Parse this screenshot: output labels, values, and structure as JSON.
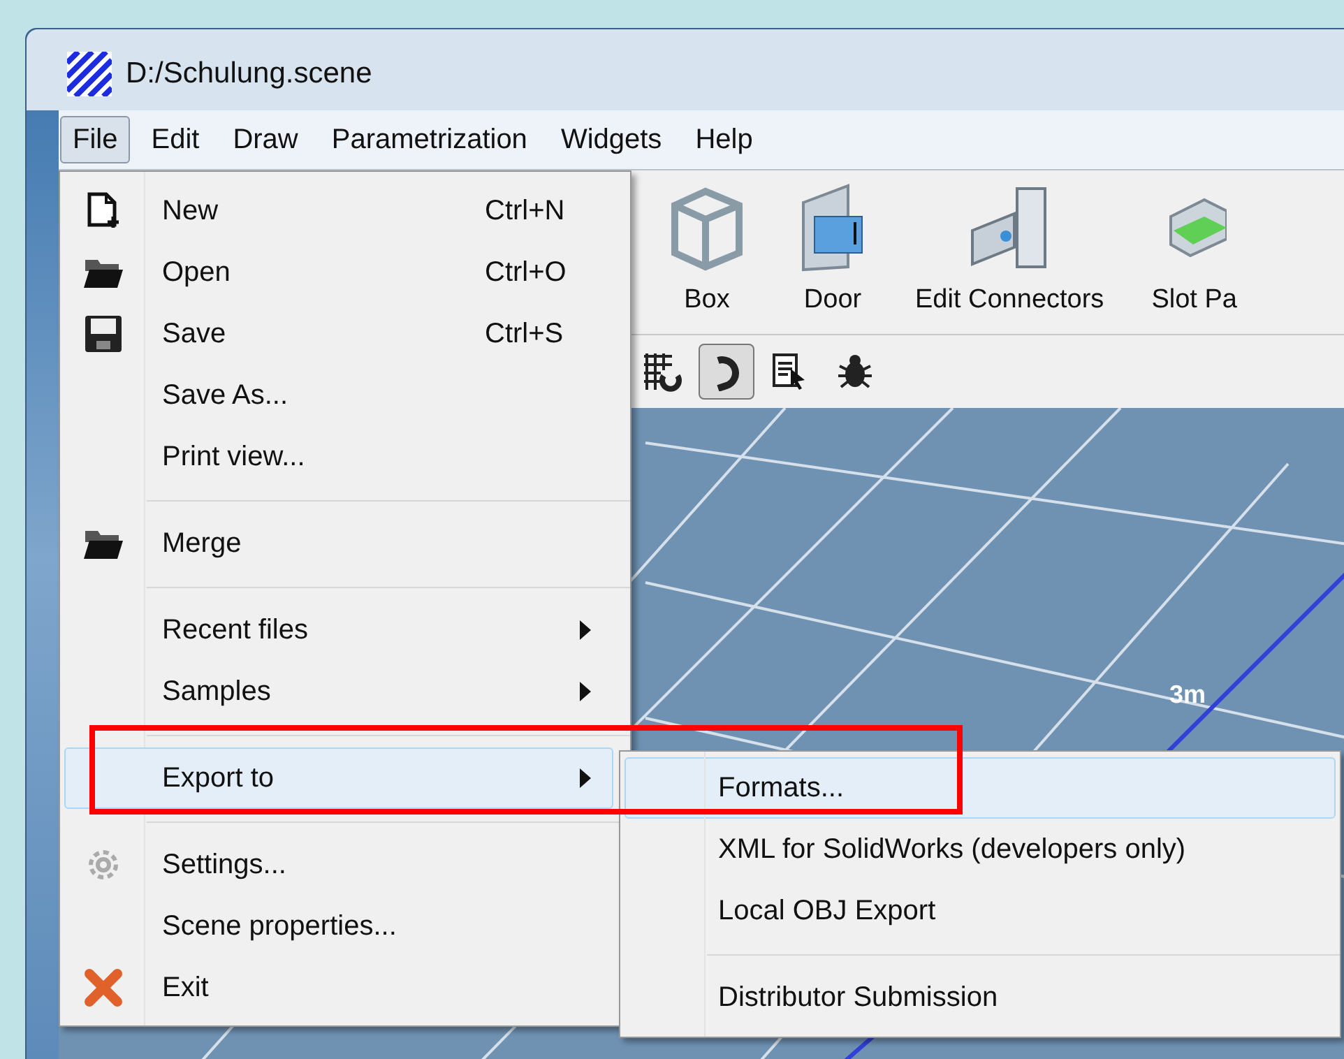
{
  "window": {
    "title": "D:/Schulung.scene"
  },
  "menubar": [
    {
      "label": "File",
      "selected": true
    },
    {
      "label": "Edit",
      "selected": false
    },
    {
      "label": "Draw",
      "selected": false
    },
    {
      "label": "Parametrization",
      "selected": false
    },
    {
      "label": "Widgets",
      "selected": false
    },
    {
      "label": "Help",
      "selected": false
    }
  ],
  "toolbar": [
    {
      "label": "Box"
    },
    {
      "label": "Door"
    },
    {
      "label": "Edit Connectors"
    },
    {
      "label": "Slot Pa"
    }
  ],
  "toolbar_small": [
    {
      "on": false
    },
    {
      "on": true
    },
    {
      "on": false
    },
    {
      "on": false
    }
  ],
  "viewport": {
    "label": "3m"
  },
  "file_menu": [
    {
      "kind": "item",
      "label": "New",
      "shortcut": "Ctrl+N",
      "submenu": false,
      "selected": false
    },
    {
      "kind": "item",
      "label": "Open",
      "shortcut": "Ctrl+O",
      "submenu": false,
      "selected": false
    },
    {
      "kind": "item",
      "label": "Save",
      "shortcut": "Ctrl+S",
      "submenu": false,
      "selected": false
    },
    {
      "kind": "item",
      "label": "Save As...",
      "submenu": false,
      "selected": false
    },
    {
      "kind": "item",
      "label": "Print view...",
      "submenu": false,
      "selected": false
    },
    {
      "kind": "separator"
    },
    {
      "kind": "item",
      "label": "Merge",
      "submenu": false,
      "selected": false
    },
    {
      "kind": "separator"
    },
    {
      "kind": "item",
      "label": "Recent files",
      "submenu": true,
      "selected": false
    },
    {
      "kind": "item",
      "label": "Samples",
      "submenu": true,
      "selected": false
    },
    {
      "kind": "separator"
    },
    {
      "kind": "item",
      "label": "Export to",
      "submenu": true,
      "selected": true
    },
    {
      "kind": "separator"
    },
    {
      "kind": "item",
      "label": "Settings...",
      "submenu": false,
      "selected": false
    },
    {
      "kind": "item",
      "label": "Scene properties...",
      "submenu": false,
      "selected": false
    },
    {
      "kind": "item",
      "label": "Exit",
      "submenu": false,
      "selected": false
    }
  ],
  "export_submenu": [
    {
      "kind": "item",
      "label": "Formats...",
      "selected": true
    },
    {
      "kind": "item",
      "label": "XML for SolidWorks (developers only)",
      "selected": false
    },
    {
      "kind": "item",
      "label": "Local OBJ Export",
      "selected": false
    },
    {
      "kind": "separator"
    },
    {
      "kind": "item",
      "label": "Distributor Submission",
      "selected": false
    }
  ]
}
